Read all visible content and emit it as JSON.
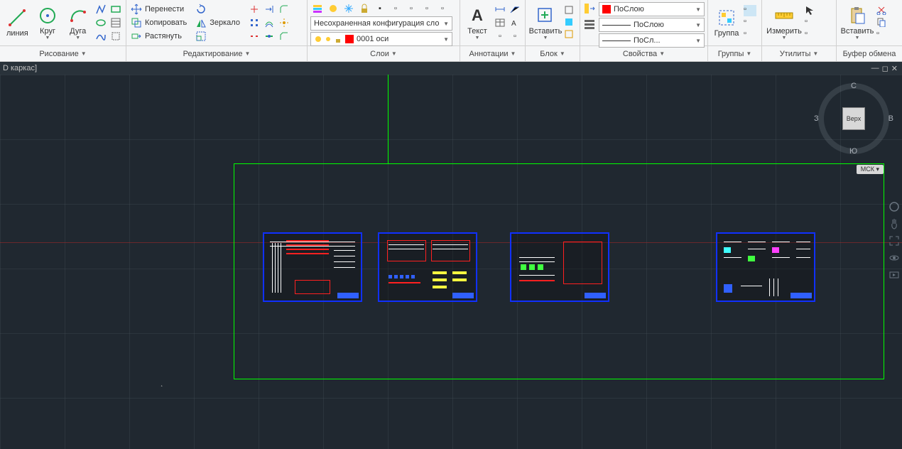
{
  "document_title": "D каркас]",
  "ribbon": {
    "draw": {
      "title": "Рисование",
      "line": "линия",
      "circle": "Круг",
      "arc": "Дуга"
    },
    "edit": {
      "title": "Редактирование",
      "move": "Перенести",
      "copy": "Копировать",
      "stretch": "Растянуть",
      "mirror": "Зеркало"
    },
    "layers": {
      "title": "Слои",
      "combo1": "Несохраненная конфигурация сло",
      "combo2": "0001 оси"
    },
    "annot": {
      "title": "Аннотации",
      "text": "Текст"
    },
    "block": {
      "title": "Блок",
      "insert": "Вставить"
    },
    "props": {
      "title": "Свойства",
      "bylayer": "ПоСлою",
      "byblock1": "ПоСлою",
      "byblock2": "ПоСл..."
    },
    "groups": {
      "title": "Группы",
      "group": "Группа"
    },
    "utils": {
      "title": "Утилиты",
      "measure": "Измерить"
    },
    "clipboard": {
      "title": "Буфер обмена",
      "paste": "Вставить"
    }
  },
  "navcube": {
    "top": "Верх",
    "n": "С",
    "s": "Ю",
    "e": "В",
    "w": "З",
    "badge": "МСК"
  }
}
